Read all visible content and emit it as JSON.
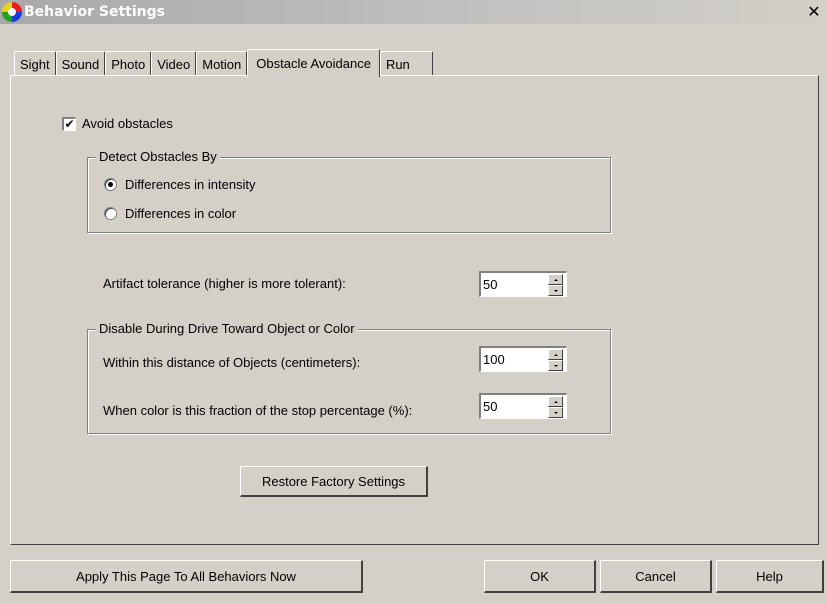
{
  "window": {
    "title": "Behavior Settings",
    "close_glyph": "✕",
    "icon": "app-logo-icon"
  },
  "tabs": [
    {
      "label": "Sight",
      "active": false
    },
    {
      "label": "Sound",
      "active": false
    },
    {
      "label": "Photo",
      "active": false
    },
    {
      "label": "Video",
      "active": false
    },
    {
      "label": "Motion",
      "active": false
    },
    {
      "label": "Obstacle Avoidance",
      "active": true
    },
    {
      "label": "Run",
      "active": false
    }
  ],
  "avoid": {
    "label": "Avoid obstacles",
    "checked": true,
    "check_glyph": "✔"
  },
  "detect_group": {
    "title": "Detect Obstacles By",
    "options": [
      {
        "label": "Differences in intensity",
        "selected": true
      },
      {
        "label": "Differences in color",
        "selected": false
      }
    ]
  },
  "artifact": {
    "label": "Artifact tolerance (higher is more tolerant):",
    "value": "50"
  },
  "disable_group": {
    "title": "Disable During Drive Toward Object or Color",
    "distance_label": "Within this distance of Objects (centimeters):",
    "distance_value": "100",
    "fraction_label": "When color is this fraction of the stop percentage (%):",
    "fraction_value": "50"
  },
  "buttons": {
    "restore": "Restore Factory Settings",
    "apply_all": "Apply This Page To All Behaviors Now",
    "ok": "OK",
    "cancel": "Cancel",
    "help": "Help"
  }
}
